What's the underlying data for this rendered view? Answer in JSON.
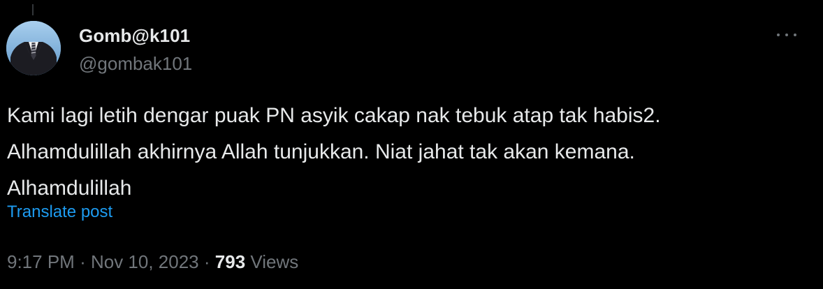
{
  "author": {
    "display_name": "Gomb@k101",
    "handle": "@gombak101"
  },
  "menu": {
    "more_icon": "more-horizontal-icon"
  },
  "post": {
    "lines": [
      "Kami lagi letih dengar puak PN asyik cakap nak tebuk atap tak habis2.",
      "Alhamdulillah akhirnya Allah tunjukkan. Niat jahat tak akan kemana.",
      "Alhamdulillah"
    ],
    "translate_label": "Translate post"
  },
  "meta": {
    "time": "9:17 PM",
    "separator": "·",
    "date": "Nov 10, 2023",
    "views_count": "793",
    "views_label": "Views"
  },
  "colors": {
    "background": "#000000",
    "text_primary": "#e7e9ea",
    "text_secondary": "#71767b",
    "link": "#1d9bf0"
  }
}
